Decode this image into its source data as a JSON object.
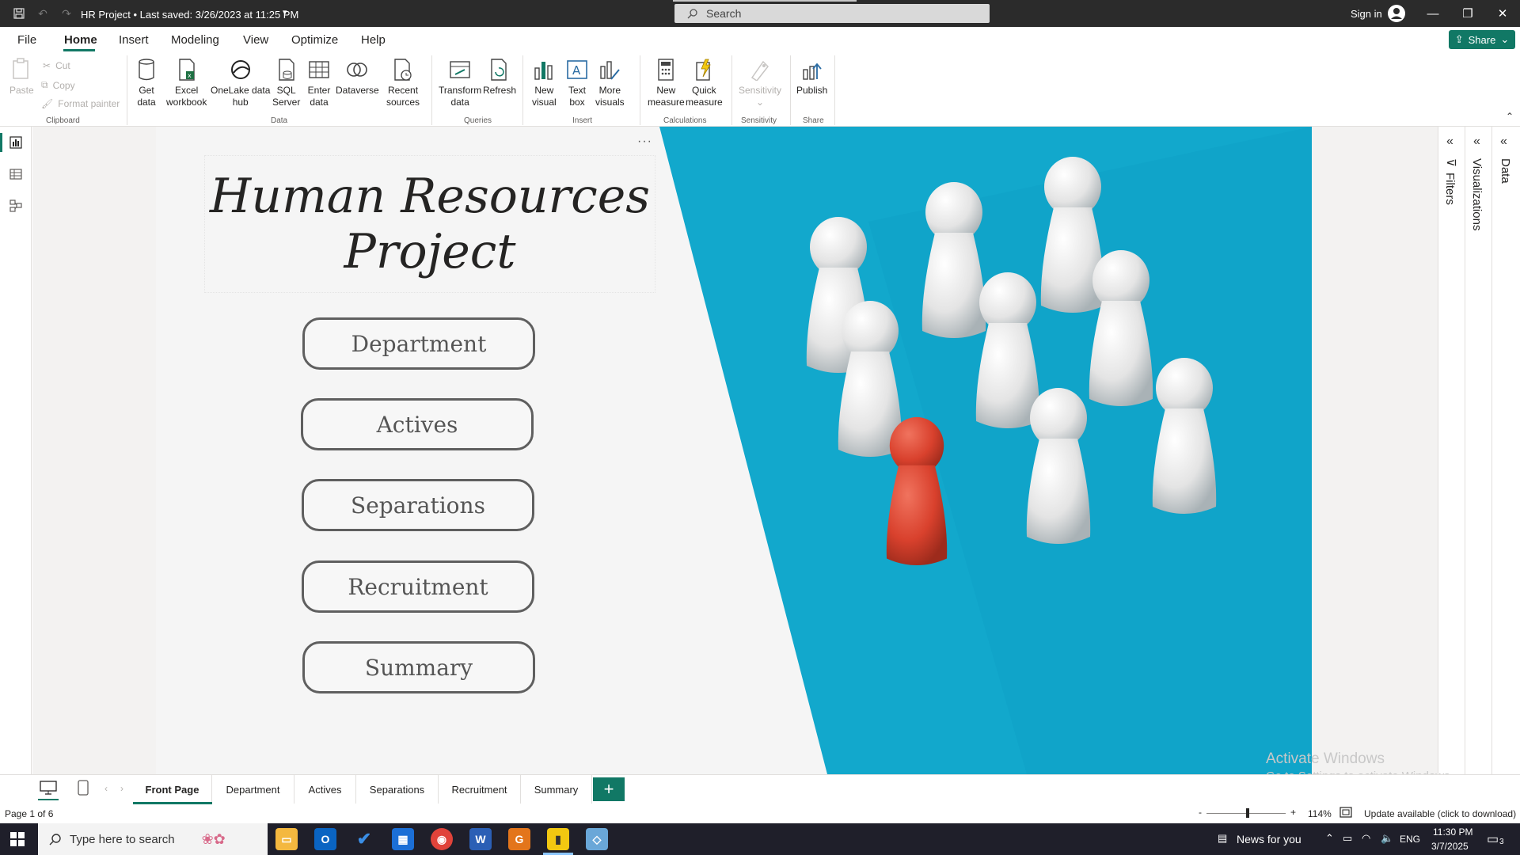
{
  "window": {
    "title": "HR Project • Last saved: 3/26/2023 at 11:25 PM",
    "search_placeholder": "Search",
    "sign_in": "Sign in"
  },
  "menu": {
    "tabs": [
      "File",
      "Home",
      "Insert",
      "Modeling",
      "View",
      "Optimize",
      "Help"
    ],
    "active": "Home",
    "share_label": "Share"
  },
  "ribbon": {
    "clipboard": {
      "paste": "Paste",
      "cut": "Cut",
      "copy": "Copy",
      "format_painter": "Format painter",
      "group": "Clipboard"
    },
    "data": {
      "get_data": [
        "Get",
        "data"
      ],
      "excel": [
        "Excel",
        "workbook"
      ],
      "onelake": [
        "OneLake data",
        "hub"
      ],
      "sql": [
        "SQL",
        "Server"
      ],
      "enter": [
        "Enter",
        "data"
      ],
      "dataverse": "Dataverse",
      "recent": [
        "Recent",
        "sources"
      ],
      "group": "Data"
    },
    "queries": {
      "transform": [
        "Transform",
        "data"
      ],
      "refresh": "Refresh",
      "group": "Queries"
    },
    "insert": {
      "new_visual": [
        "New",
        "visual"
      ],
      "text_box": [
        "Text",
        "box"
      ],
      "more_visuals": [
        "More",
        "visuals"
      ],
      "group": "Insert"
    },
    "calculations": {
      "new_measure": [
        "New",
        "measure"
      ],
      "quick_measure": [
        "Quick",
        "measure"
      ],
      "group": "Calculations"
    },
    "sensitivity": {
      "label": "Sensitivity",
      "group": "Sensitivity"
    },
    "share": {
      "publish": "Publish",
      "group": "Share"
    }
  },
  "report": {
    "title_line1": "Human Resources",
    "title_line2": "Project",
    "nav_buttons": [
      "Department",
      "Actives",
      "Separations",
      "Recruitment",
      "Summary"
    ]
  },
  "panes": {
    "filters": "Filters",
    "visualizations": "Visualizations",
    "data": "Data"
  },
  "watermark": {
    "line1": "Activate Windows",
    "line2": "Go to Settings to activate Windows."
  },
  "page_tabs": [
    "Front Page",
    "Department",
    "Actives",
    "Separations",
    "Recruitment",
    "Summary"
  ],
  "active_page": "Front Page",
  "status": {
    "page": "Page 1 of 6",
    "zoom": "114%",
    "update": "Update available (click to download)"
  },
  "taskbar": {
    "search_placeholder": "Type here to search",
    "news": "News for you",
    "lang": "ENG",
    "time": "11:30 PM",
    "date": "3/7/2025",
    "notifications": "3"
  },
  "colors": {
    "accent": "#117865",
    "photo_bg": "#12a8cc",
    "red_pawn": "#d9412d"
  }
}
